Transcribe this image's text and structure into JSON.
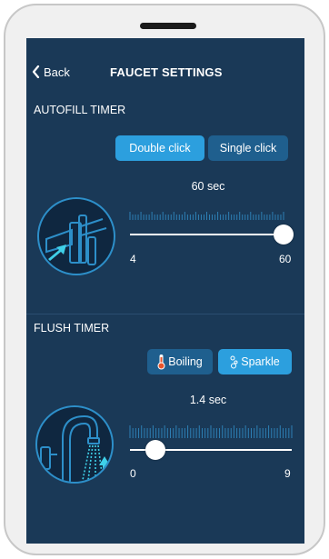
{
  "header": {
    "back_label": "Back",
    "title": "FAUCET SETTINGS"
  },
  "autofill": {
    "section_title": "AUTOFILL TIMER",
    "buttons": [
      {
        "label": "Double click",
        "active": true
      },
      {
        "label": "Single click",
        "active": false
      }
    ],
    "value_label": "60 sec",
    "min_label": "4",
    "max_label": "60",
    "value": 60,
    "min": 4,
    "max": 60
  },
  "flush": {
    "section_title": "FLUSH TIMER",
    "buttons": [
      {
        "label": "Boiling",
        "icon": "thermometer-icon",
        "active": false
      },
      {
        "label": "Sparkle",
        "icon": "bubbles-icon",
        "active": true
      }
    ],
    "value_label": "1.4 sec",
    "min_label": "0",
    "max_label": "9",
    "value": 1.4,
    "min": 0,
    "max": 9
  },
  "colors": {
    "screen_bg": "#1a3957",
    "accent": "#2c9fde",
    "inactive_button": "#1f5f8e",
    "track_fill": "#ffffff",
    "tick": "#2d7fb4"
  }
}
